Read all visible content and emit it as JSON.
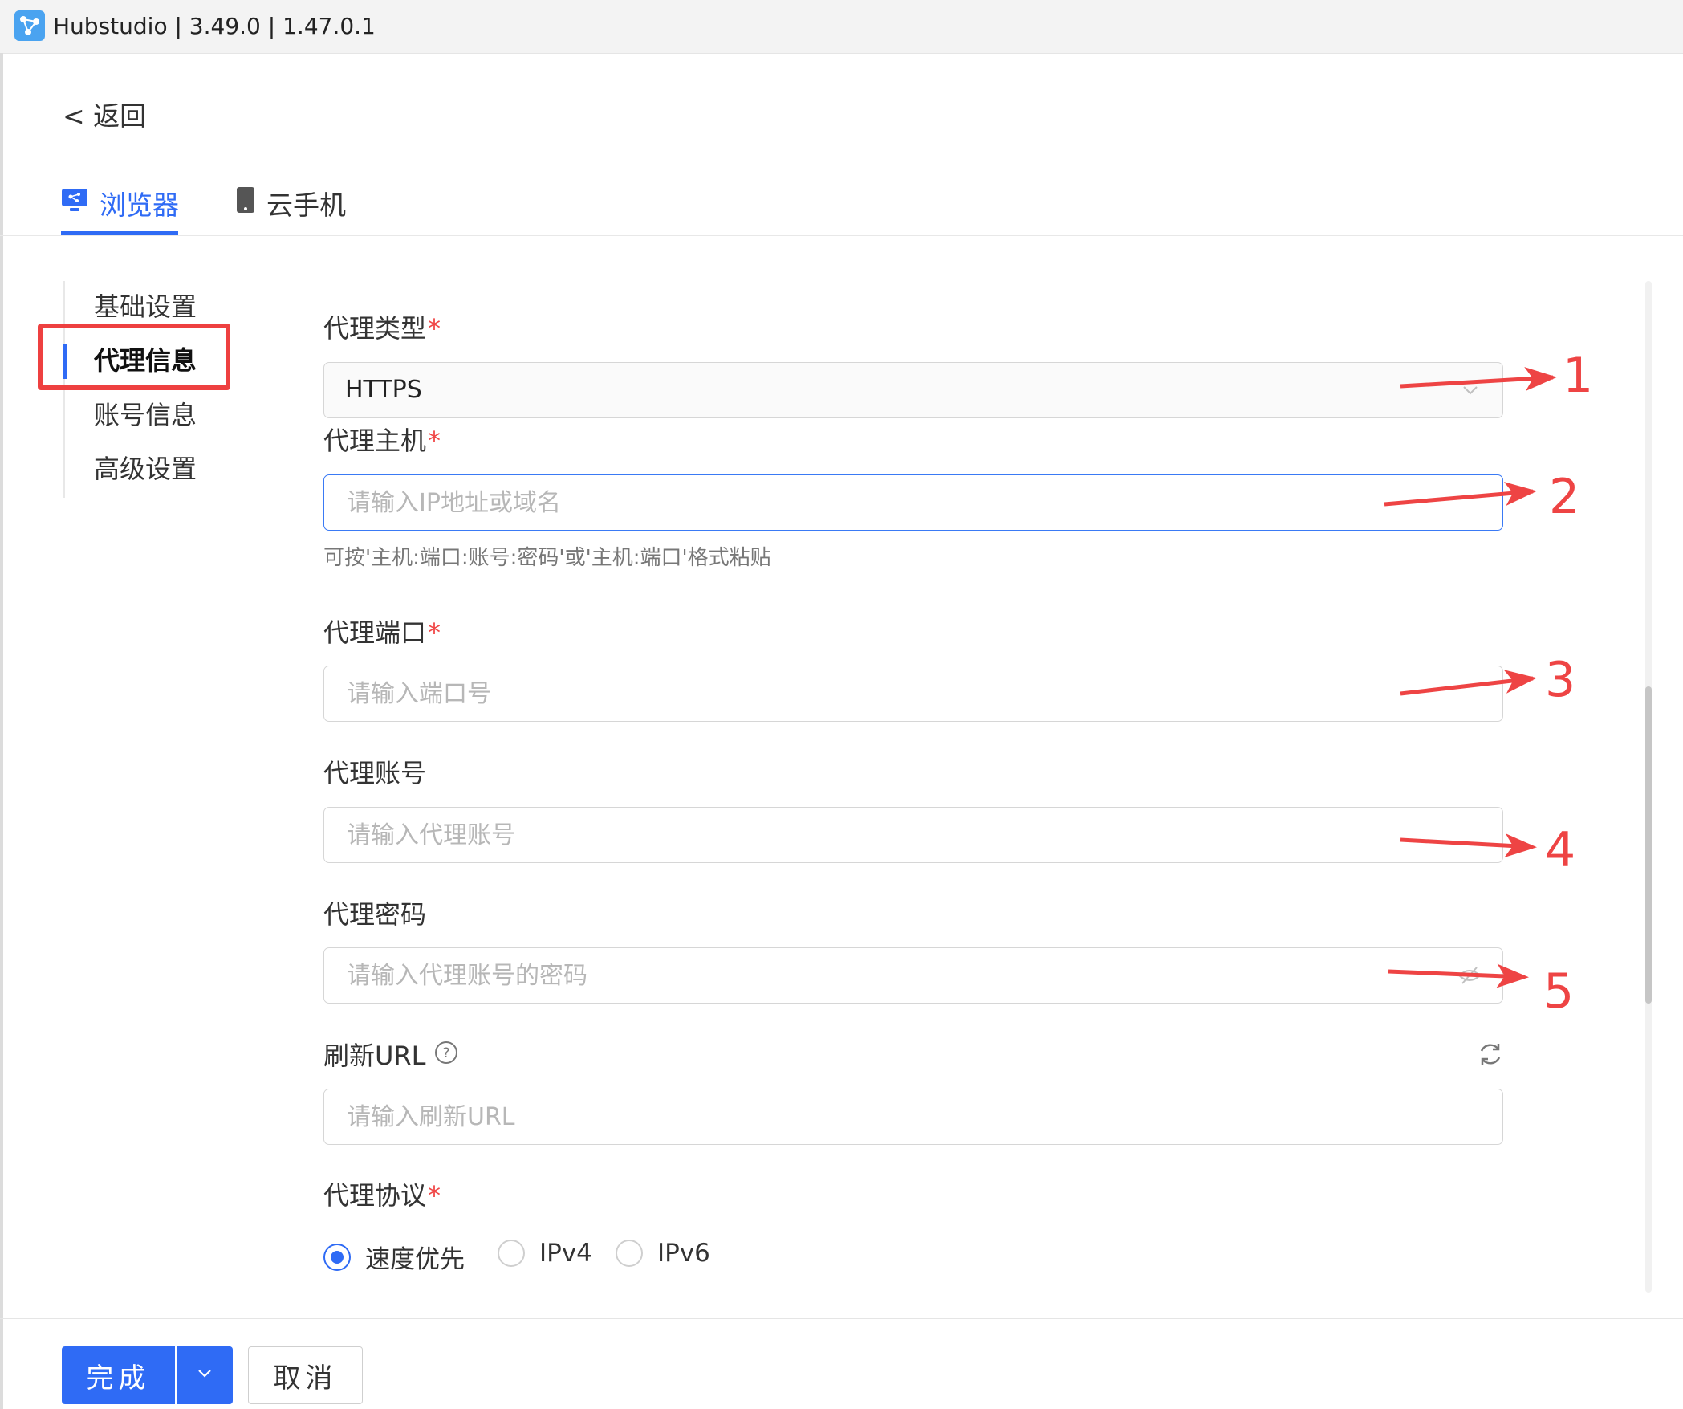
{
  "window": {
    "title": "Hubstudio | 3.49.0 | 1.47.0.1"
  },
  "nav": {
    "back_label": "< 返回"
  },
  "tabs": [
    {
      "label": "浏览器",
      "active": true
    },
    {
      "label": "云手机",
      "active": false
    }
  ],
  "sidebar": {
    "items": [
      {
        "label": "基础设置"
      },
      {
        "label": "代理信息",
        "active": true
      },
      {
        "label": "账号信息"
      },
      {
        "label": "高级设置"
      }
    ]
  },
  "form": {
    "proxy_type": {
      "label": "代理类型",
      "required_mark": "*",
      "value": "HTTPS"
    },
    "proxy_host": {
      "label": "代理主机",
      "required_mark": "*",
      "placeholder": "请输入IP地址或域名",
      "hint": "可按'主机:端口:账号:密码'或'主机:端口'格式粘贴"
    },
    "proxy_port": {
      "label": "代理端口",
      "required_mark": "*",
      "placeholder": "请输入端口号"
    },
    "proxy_account": {
      "label": "代理账号",
      "placeholder": "请输入代理账号"
    },
    "proxy_password": {
      "label": "代理密码",
      "placeholder": "请输入代理账号的密码"
    },
    "refresh_url": {
      "label": "刷新URL",
      "placeholder": "请输入刷新URL"
    },
    "proxy_protocol": {
      "label": "代理协议",
      "required_mark": "*",
      "options": [
        {
          "label": "速度优先",
          "checked": true
        },
        {
          "label": "IPv4",
          "checked": false
        },
        {
          "label": "IPv6",
          "checked": false
        }
      ]
    }
  },
  "footer": {
    "done_label": "完成",
    "cancel_label": "取消"
  },
  "annotations": [
    "1",
    "2",
    "3",
    "4",
    "5"
  ],
  "colors": {
    "accent": "#2f6bf5",
    "annotation": "#ee4444",
    "required": "#f04747"
  }
}
